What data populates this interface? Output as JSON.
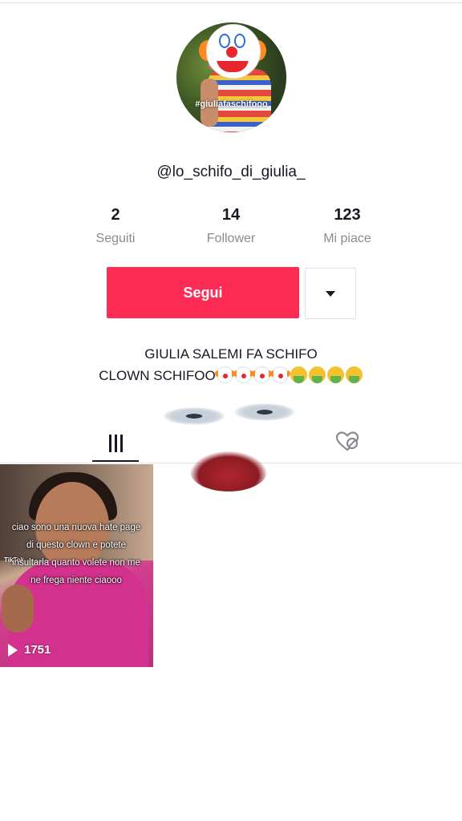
{
  "profile": {
    "avatar_watermark": "#giuliafaschifooo",
    "username": "@lo_schifo_di_giulia_",
    "stats": [
      {
        "value": "2",
        "label": "Seguiti"
      },
      {
        "value": "14",
        "label": "Follower"
      },
      {
        "value": "123",
        "label": "Mi piace"
      }
    ],
    "follow_label": "Segui",
    "bio_line1": "GIULIA SALEMI FA SCHIFO",
    "bio_line2_text": "CLOWN SCHIFOO",
    "bio_emojis": [
      "clown-face",
      "clown-face",
      "clown-face",
      "clown-face",
      "vomiting-face",
      "vomiting-face",
      "vomiting-face",
      "vomiting-face"
    ]
  },
  "tabs": {
    "videos_icon": "grid-bars-icon",
    "liked_icon": "heart-hidden-icon"
  },
  "videos": [
    {
      "caption": "ciao sono una nuova hate page di questo clown e potete insultarla quanto volete non me ne frega niente ciaooo",
      "watermark": "TikTok",
      "play_count": "1751"
    }
  ],
  "colors": {
    "accent": "#fe2c55",
    "text": "#161823",
    "muted": "#8a8b91"
  }
}
